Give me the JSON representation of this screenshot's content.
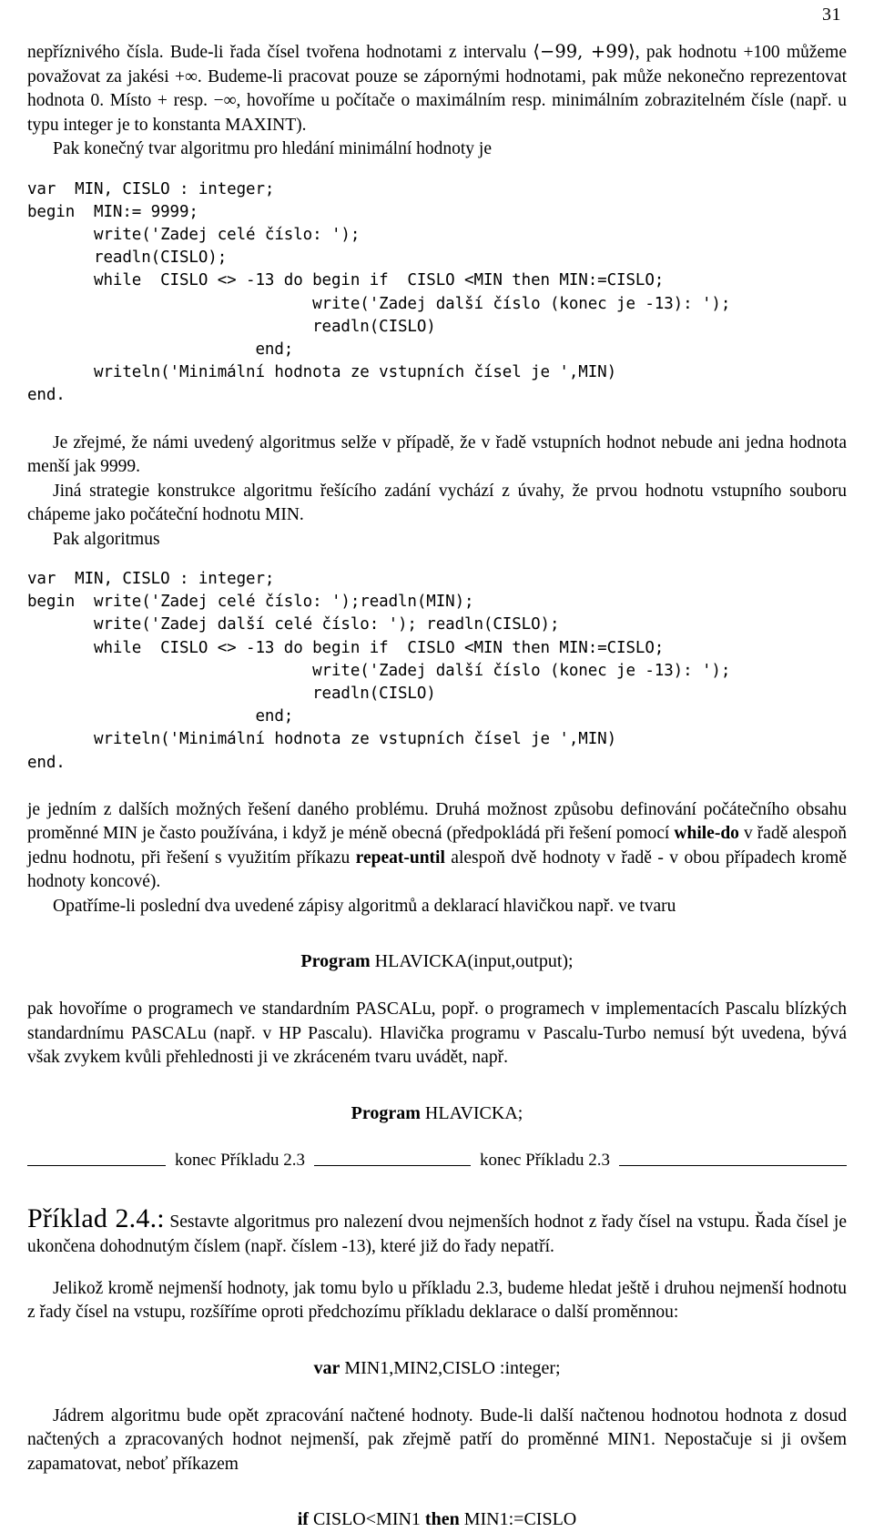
{
  "page": {
    "folio": "31"
  },
  "paragraphs": {
    "intro": {
      "p1_a": "nepříznivého čísla. Bude-li řada čísel tvořena hodnotami z intervalu ",
      "p1_interval": "⟨−99, +99⟩",
      "p1_b": ", pak hodnotu +100 můžeme považovat za jakési +∞. Budeme-li pracovat pouze se zápornými hodnotami, pak může nekonečno reprezentovat hodnota 0. Místo + resp. −∞, hovoříme u počítače o maximálním resp. minimálním zobrazitelném čísle (např. u typu integer je to konstanta MAXINT).",
      "p2": "Pak konečný tvar algoritmu pro hledání minimální hodnoty je"
    },
    "after_code1": {
      "p1": "Je zřejmé, že námi uvedený algoritmus selže v případě, že v řadě vstupních hodnot nebude ani jedna hodnota menší jak 9999.",
      "p2": "Jiná strategie konstrukce algoritmu řešícího zadání vychází z úvahy, že prvou hodnotu vstupního souboru chápeme jako počáteční hodnotu MIN.",
      "p3": "Pak algoritmus"
    },
    "after_code2": {
      "p1_a": "je jedním z dalších možných řešení daného problému. Druhá možnost způsobu definování počátečního obsahu proměnné MIN je často používána, i když je méně obecná (předpokládá při řešení pomocí ",
      "p1_bold1": "while-do",
      "p1_b": " v řadě alespoň jednu hodnotu, při řešení s využitím příkazu ",
      "p1_bold2": "repeat-until",
      "p1_c": " alespoň dvě hodnoty v řadě - v obou případech kromě hodnoty koncové).",
      "p2": "Opatříme-li poslední dva uvedené zápisy algoritmů a deklarací hlavičkou např. ve tvaru"
    },
    "after_hlavicka1": {
      "p1": "pak hovoříme o programech ve standardním PASCALu, popř. o programech v implementacích Pascalu blízkých standardnímu PASCALu (např. v HP Pascalu). Hlavička programu v Pascalu-Turbo nemusí být uvedena, bývá však zvykem kvůli přehlednosti ji ve zkráceném tvaru uvádět, např."
    },
    "priklad24": {
      "head": "Příklad 2.4.:",
      "body": " Sestavte algoritmus pro nalezení dvou nejmenších hodnot z řady čísel na vstupu. Řada čísel je ukončena dohodnutým číslem (např. číslem -13), které již do řady nepatří.",
      "p2": "Jelikož kromě nejmenší hodnoty, jak tomu bylo u příkladu 2.3, budeme hledat ještě i druhou nejmenší hodnotu z řady čísel na vstupu, rozšíříme oproti předchozímu příkladu deklarace o další proměnnou:",
      "p3": "Jádrem algoritmu bude opět zpracování načtené hodnoty. Bude-li další načtenou hodnotou hodnota z dosud načtených a zpracovaných hodnot nejmenší, pak zřejmě patří do proměnné MIN1. Nepostačuje si ji ovšem zapamatovat, neboť příkazem"
    }
  },
  "code_blocks": {
    "block1": "var  MIN, CISLO : integer;\nbegin  MIN:= 9999;\n       write('Zadej celé číslo: ');\n       readln(CISLO);\n       while  CISLO <> -13 do begin if  CISLO <MIN then MIN:=CISLO;\n                              write('Zadej další číslo (konec je -13): ');\n                              readln(CISLO)\n                        end;\n       writeln('Minimální hodnota ze vstupních čísel je ',MIN)\nend.",
    "block2": "var  MIN, CISLO : integer;\nbegin  write('Zadej celé číslo: ');readln(MIN);\n       write('Zadej další celé číslo: '); readln(CISLO);\n       while  CISLO <> -13 do begin if  CISLO <MIN then MIN:=CISLO;\n                              write('Zadej další číslo (konec je -13): ');\n                              readln(CISLO)\n                        end;\n       writeln('Minimální hodnota ze vstupních čísel je ',MIN)\nend."
  },
  "display_lines": {
    "hlavicka_full_bold": "Program",
    "hlavicka_full_rest": " HLAVICKA(input,output);",
    "hlavicka_short_bold": "Program",
    "hlavicka_short_rest": " HLAVICKA;",
    "var_decl_bold": "var",
    "var_decl_rest": " MIN1,MIN2,CISLO :integer;",
    "if_bold1": "if",
    "if_rest1": " CISLO<MIN1 ",
    "if_bold2": "then",
    "if_rest2": " MIN1:=CISLO"
  },
  "separator": {
    "label_left": "konec Příkladu 2.3",
    "label_right": "konec Příkladu 2.3"
  }
}
